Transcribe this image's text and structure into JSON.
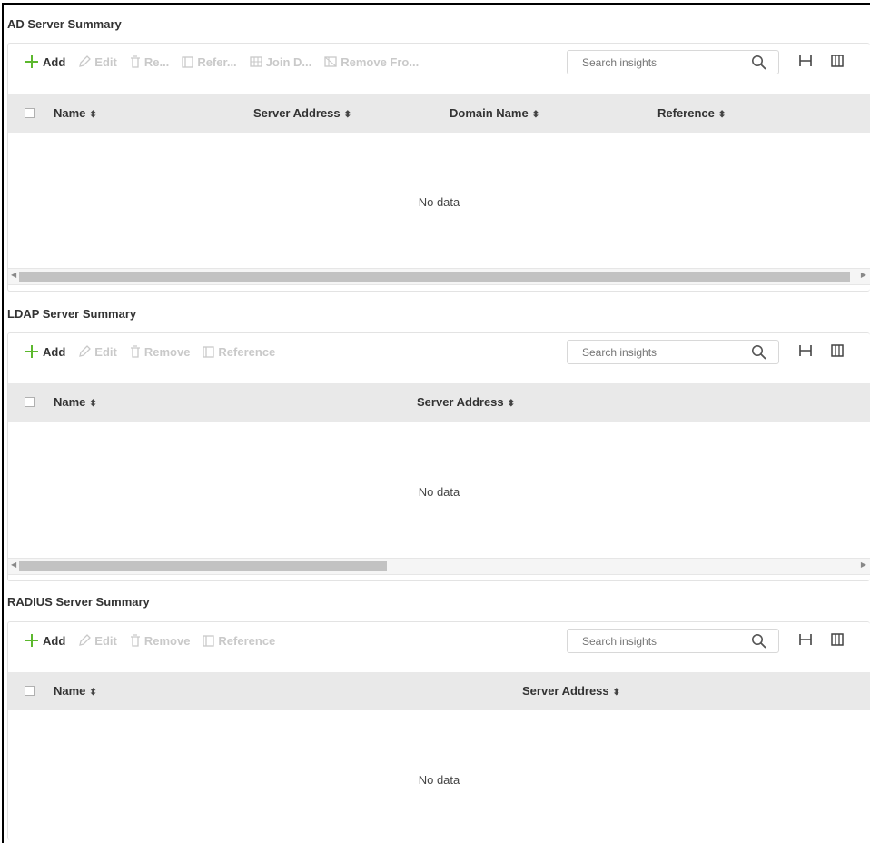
{
  "ad": {
    "title": "AD Server Summary",
    "toolbar": {
      "add": "Add",
      "edit": "Edit",
      "remove": "Re...",
      "reference": "Refer...",
      "join_domain": "Join D...",
      "remove_from": "Remove Fro..."
    },
    "search_placeholder": "Search insights",
    "columns": [
      "Name",
      "Server Address",
      "Domain Name",
      "Reference"
    ],
    "empty_text": "No data"
  },
  "ldap": {
    "title": "LDAP Server Summary",
    "toolbar": {
      "add": "Add",
      "edit": "Edit",
      "remove": "Remove",
      "reference": "Reference"
    },
    "search_placeholder": "Search insights",
    "columns": [
      "Name",
      "Server Address"
    ],
    "empty_text": "No data"
  },
  "radius": {
    "title": "RADIUS Server Summary",
    "toolbar": {
      "add": "Add",
      "edit": "Edit",
      "remove": "Remove",
      "reference": "Reference"
    },
    "search_placeholder": "Search insights",
    "columns": [
      "Name",
      "Server Address"
    ],
    "empty_text": "No data"
  },
  "colors": {
    "accent_green": "#5cb82e",
    "disabled": "#c9c9c9",
    "header_bg": "#e9e9e9"
  },
  "icons": [
    "plus-icon",
    "edit-icon",
    "trash-icon",
    "reference-icon",
    "join-domain-icon",
    "remove-from-domain-icon",
    "search-icon",
    "column-width-icon",
    "columns-icon",
    "sort-icon"
  ]
}
